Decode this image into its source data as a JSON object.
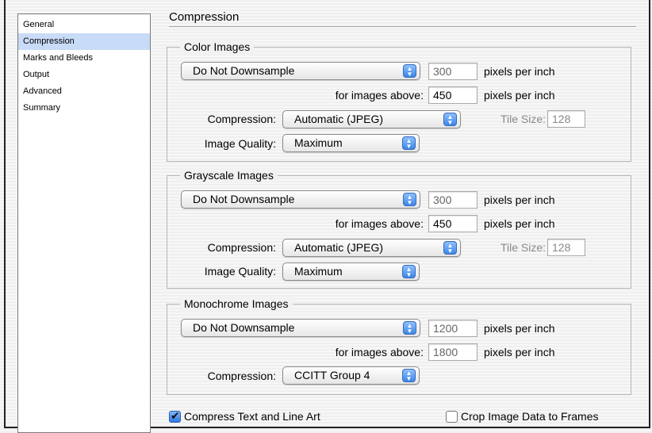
{
  "sidebar": {
    "items": [
      {
        "label": "General",
        "selected": false
      },
      {
        "label": "Compression",
        "selected": true
      },
      {
        "label": "Marks and Bleeds",
        "selected": false
      },
      {
        "label": "Output",
        "selected": false
      },
      {
        "label": "Advanced",
        "selected": false
      },
      {
        "label": "Summary",
        "selected": false
      }
    ]
  },
  "page_title": "Compression",
  "color": {
    "legend": "Color Images",
    "downsample": "Do Not Downsample",
    "ppi": "300",
    "ppi_unit": "pixels per inch",
    "above_label": "for images above:",
    "above_value": "450",
    "above_unit": "pixels per inch",
    "compression_label": "Compression:",
    "compression": "Automatic (JPEG)",
    "tile_label": "Tile Size:",
    "tile_value": "128",
    "quality_label": "Image Quality:",
    "quality": "Maximum"
  },
  "grayscale": {
    "legend": "Grayscale Images",
    "downsample": "Do Not Downsample",
    "ppi": "300",
    "ppi_unit": "pixels per inch",
    "above_label": "for images above:",
    "above_value": "450",
    "above_unit": "pixels per inch",
    "compression_label": "Compression:",
    "compression": "Automatic (JPEG)",
    "tile_label": "Tile Size:",
    "tile_value": "128",
    "quality_label": "Image Quality:",
    "quality": "Maximum"
  },
  "monochrome": {
    "legend": "Monochrome Images",
    "downsample": "Do Not Downsample",
    "ppi": "1200",
    "ppi_unit": "pixels per inch",
    "above_label": "for images above:",
    "above_value": "1800",
    "above_unit": "pixels per inch",
    "compression_label": "Compression:",
    "compression": "CCITT Group 4"
  },
  "options": {
    "compress_text": {
      "label": "Compress Text and Line Art",
      "checked": true
    },
    "crop_image": {
      "label": "Crop Image Data to Frames",
      "checked": false
    }
  },
  "colors": {
    "selection": "#c8dbf7",
    "popup_arrow": "#3d86e8"
  }
}
